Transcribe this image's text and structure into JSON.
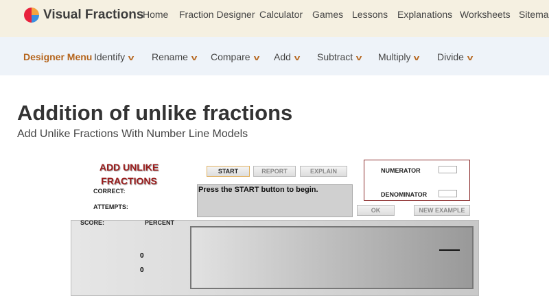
{
  "header": {
    "brand": "Visual Fractions",
    "nav": [
      "Home",
      "Fraction Designer",
      "Calculator",
      "Games",
      "Lessons",
      "Explanations",
      "Worksheets",
      "Sitemap"
    ]
  },
  "submenu": {
    "active": "Designer Menu",
    "items": [
      "Identify",
      "Rename",
      "Compare",
      "Add",
      "Subtract",
      "Multiply",
      "Divide"
    ]
  },
  "page": {
    "title": "Addition of unlike fractions",
    "subtitle": "Add Unlike Fractions With Number Line Models"
  },
  "app": {
    "title_line1": "ADD UNLIKE",
    "title_line2": "FRACTIONS",
    "correct_label": "CORRECT:",
    "attempts_label": "ATTEMPTS:",
    "score_label": "SCORE:",
    "percent_label": "PERCENT",
    "start": "START",
    "report": "REPORT",
    "explain": "EXPLAIN",
    "message": "Press the START button to begin.",
    "numerator_label": "NUMERATOR",
    "denominator_label": "DENOMINATOR",
    "ok": "OK",
    "new_example": "NEW EXAMPLE",
    "score_value": "0",
    "percent_value": "0"
  },
  "colors": {
    "accent": "#b5651d",
    "title_red": "#9b1c1c"
  }
}
